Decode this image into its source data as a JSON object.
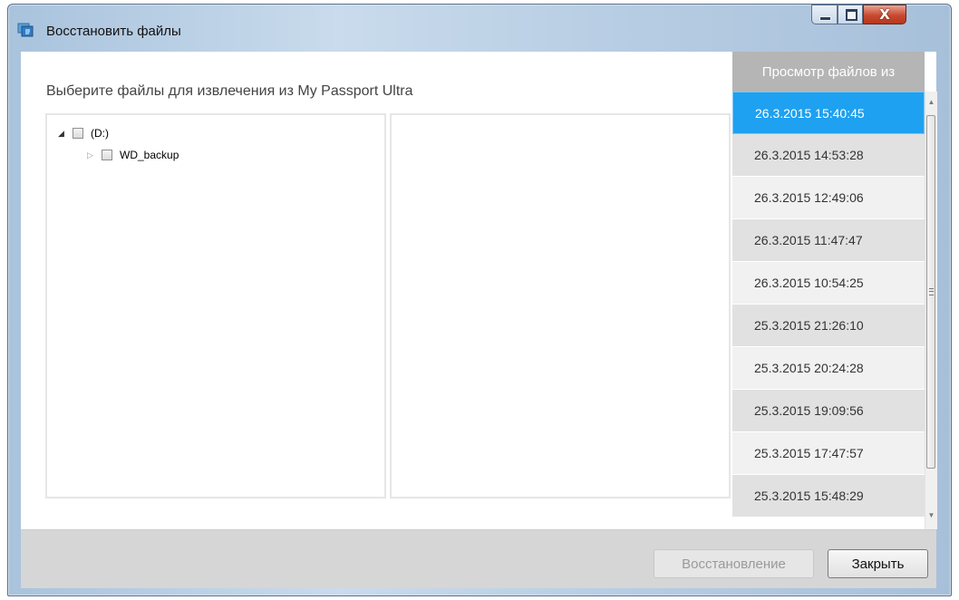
{
  "window": {
    "title": "Восстановить файлы",
    "close_glyph": "X"
  },
  "main": {
    "heading": "Выберите файлы для извлечения из My Passport Ultra",
    "tree": [
      {
        "label": "(D:)",
        "expanded": true,
        "checked": false
      },
      {
        "label": "WD_backup",
        "expanded": false,
        "checked": false
      }
    ]
  },
  "timestamps": {
    "header": "Просмотр файлов из",
    "items": [
      {
        "label": "26.3.2015 15:40:45",
        "selected": true
      },
      {
        "label": "26.3.2015 14:53:28"
      },
      {
        "label": "26.3.2015 12:49:06"
      },
      {
        "label": "26.3.2015 11:47:47"
      },
      {
        "label": "26.3.2015 10:54:25"
      },
      {
        "label": "25.3.2015 21:26:10"
      },
      {
        "label": "25.3.2015 20:24:28"
      },
      {
        "label": "25.3.2015 19:09:56"
      },
      {
        "label": "25.3.2015 17:47:57"
      },
      {
        "label": "25.3.2015 15:48:29"
      }
    ]
  },
  "footer": {
    "restore_label": "Восстановление",
    "restore_enabled": false,
    "close_label": "Закрыть"
  },
  "icons": {
    "expanded": "expanded-triangle-icon",
    "collapsed": "collapsed-triangle-icon",
    "app": "restore-files-icon"
  },
  "colors": {
    "selected": "#1ea1f0",
    "header": "#b5b5b5",
    "footer": "#d6d6d6"
  }
}
